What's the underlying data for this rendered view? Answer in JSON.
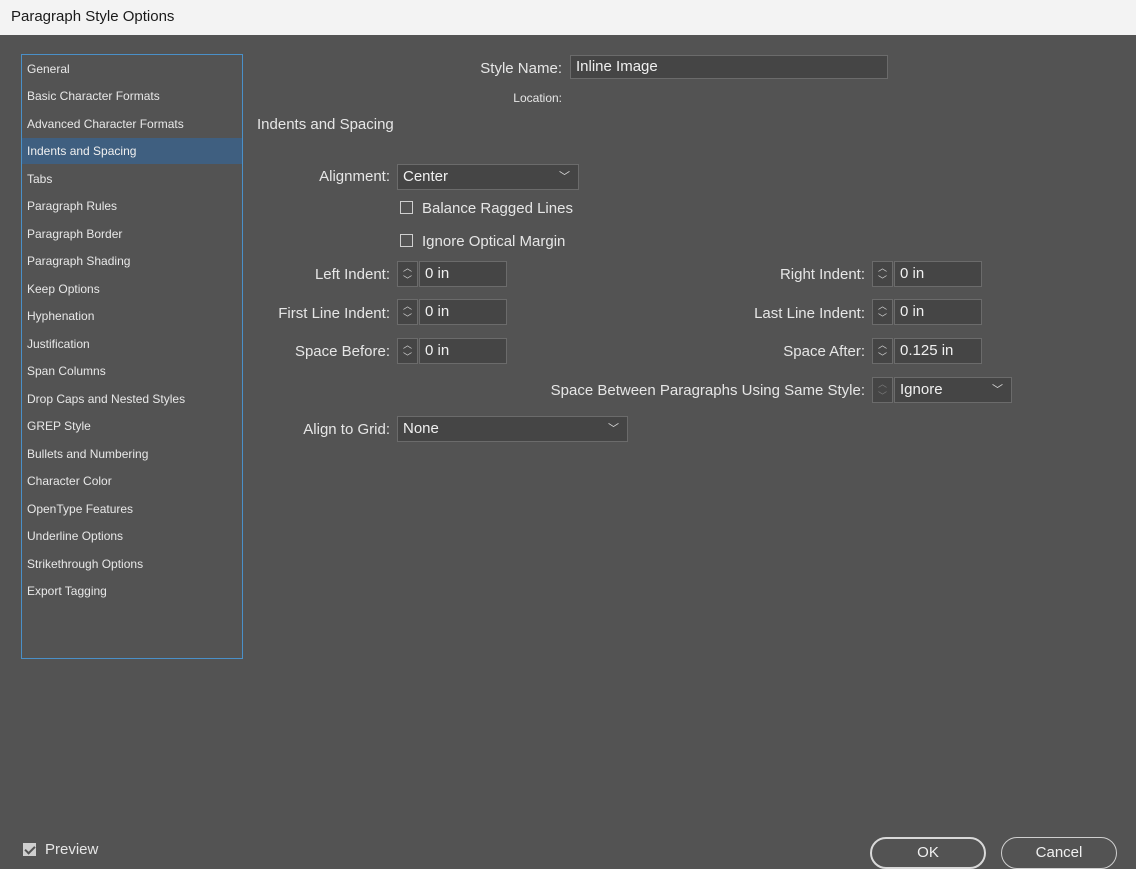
{
  "window": {
    "title": "Paragraph Style Options"
  },
  "sidebar": {
    "items": [
      {
        "label": "General"
      },
      {
        "label": "Basic Character Formats"
      },
      {
        "label": "Advanced Character Formats"
      },
      {
        "label": "Indents and Spacing",
        "selected": true
      },
      {
        "label": "Tabs"
      },
      {
        "label": "Paragraph Rules"
      },
      {
        "label": "Paragraph Border"
      },
      {
        "label": "Paragraph Shading"
      },
      {
        "label": "Keep Options"
      },
      {
        "label": "Hyphenation"
      },
      {
        "label": "Justification"
      },
      {
        "label": "Span Columns"
      },
      {
        "label": "Drop Caps and Nested Styles"
      },
      {
        "label": "GREP Style"
      },
      {
        "label": "Bullets and Numbering"
      },
      {
        "label": "Character Color"
      },
      {
        "label": "OpenType Features"
      },
      {
        "label": "Underline Options"
      },
      {
        "label": "Strikethrough Options"
      },
      {
        "label": "Export Tagging"
      }
    ]
  },
  "header": {
    "style_name_label": "Style Name:",
    "style_name_value": "Inline Image",
    "location_label": "Location:",
    "section_title": "Indents and Spacing"
  },
  "form": {
    "alignment_label": "Alignment:",
    "alignment_value": "Center",
    "balance_ragged_label": "Balance Ragged Lines",
    "balance_ragged_checked": false,
    "ignore_optical_label": "Ignore Optical Margin",
    "ignore_optical_checked": false,
    "left_indent_label": "Left Indent:",
    "left_indent_value": "0 in",
    "right_indent_label": "Right Indent:",
    "right_indent_value": "0 in",
    "first_line_label": "First Line Indent:",
    "first_line_value": "0 in",
    "last_line_label": "Last Line Indent:",
    "last_line_value": "0 in",
    "space_before_label": "Space Before:",
    "space_before_value": "0 in",
    "space_after_label": "Space After:",
    "space_after_value": "0.125 in",
    "space_between_label": "Space Between Paragraphs Using Same Style:",
    "space_between_value": "Ignore",
    "align_grid_label": "Align to Grid:",
    "align_grid_value": "None"
  },
  "footer": {
    "preview_label": "Preview",
    "preview_checked": true,
    "ok_label": "OK",
    "cancel_label": "Cancel"
  },
  "icons": {
    "chevron": "chevron-down-icon",
    "spin_up": "chevron-up-icon",
    "spin_down": "chevron-down-icon",
    "check": "check-icon"
  },
  "colors": {
    "background": "#535353",
    "selection": "#3f5f80",
    "sidebar_border": "#4a90c8"
  }
}
